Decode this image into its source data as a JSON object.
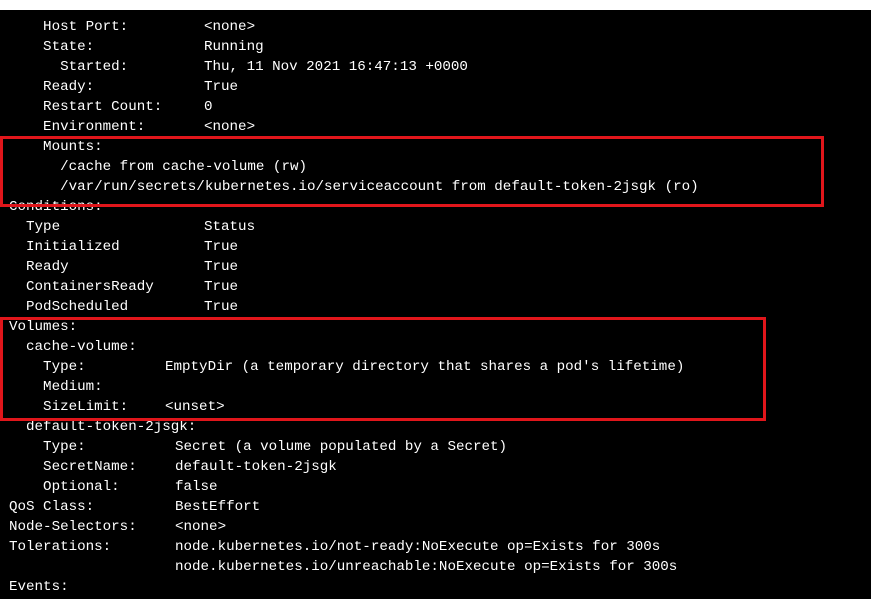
{
  "terminal": {
    "lines": [
      {
        "label": "    Host Port:",
        "value": "<none>"
      },
      {
        "label": "    State:",
        "value": "Running"
      },
      {
        "label": "      Started:",
        "value": "Thu, 11 Nov 2021 16:47:13 +0000"
      },
      {
        "label": "    Ready:",
        "value": "True"
      },
      {
        "label": "    Restart Count:",
        "value": "0"
      },
      {
        "label": "    Environment:",
        "value": "<none>"
      },
      {
        "label": "    Mounts:",
        "value": ""
      },
      {
        "label": "      /cache from cache-volume (rw)",
        "value": ""
      },
      {
        "label": "      /var/run/secrets/kubernetes.io/serviceaccount from default-token-2jsgk (ro)",
        "value": ""
      },
      {
        "label": "Conditions:",
        "value": ""
      },
      {
        "label": "  Type",
        "value": "Status"
      },
      {
        "label": "  Initialized",
        "value": "True"
      },
      {
        "label": "  Ready",
        "value": "True"
      },
      {
        "label": "  ContainersReady",
        "value": "True"
      },
      {
        "label": "  PodScheduled",
        "value": "True"
      },
      {
        "label": "Volumes:",
        "value": ""
      },
      {
        "label": "  cache-volume:",
        "value": ""
      },
      {
        "label": "    Type:",
        "value": "EmptyDir (a temporary directory that shares a pod's lifetime)"
      },
      {
        "label": "    Medium:",
        "value": ""
      },
      {
        "label": "    SizeLimit:",
        "value": "<unset>"
      },
      {
        "label": "  default-token-2jsgk:",
        "value": ""
      },
      {
        "label": "    Type:",
        "value": "Secret (a volume populated by a Secret)"
      },
      {
        "label": "    SecretName:",
        "value": "default-token-2jsgk"
      },
      {
        "label": "    Optional:",
        "value": "false"
      },
      {
        "label": "QoS Class:",
        "value": "BestEffort"
      },
      {
        "label": "Node-Selectors:",
        "value": "<none>"
      },
      {
        "label": "Tolerations:",
        "value": "node.kubernetes.io/not-ready:NoExecute op=Exists for 300s"
      },
      {
        "label": "",
        "value": "node.kubernetes.io/unreachable:NoExecute op=Exists for 300s"
      },
      {
        "label": "Events:",
        "value": ""
      }
    ]
  },
  "highlight": {
    "color": "#e0161b"
  }
}
